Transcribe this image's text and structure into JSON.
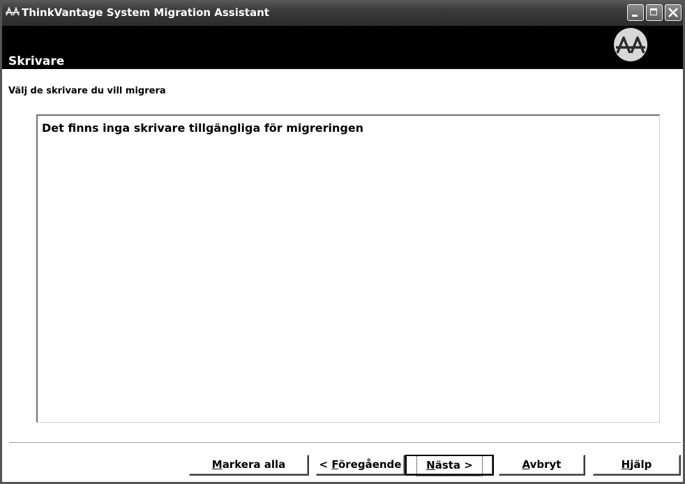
{
  "window": {
    "title": "ThinkVantage System Migration Assistant",
    "icon": "thinkvantage-app-icon"
  },
  "header": {
    "title": "Skrivare",
    "logo": "thinkvantage-logo"
  },
  "content": {
    "instruction": "Välj de skrivare du vill migrera",
    "list_empty_message": "Det finns inga skrivare tillgängliga för migreringen"
  },
  "buttons": {
    "select_all": {
      "mnemonic": "M",
      "rest": "arkera alla"
    },
    "back": {
      "prefix": "< ",
      "mnemonic": "F",
      "rest": "öregående"
    },
    "next": {
      "mnemonic": "N",
      "rest": "ästa >"
    },
    "cancel": {
      "mnemonic": "A",
      "rest": "vbryt"
    },
    "help": {
      "mnemonic": "H",
      "rest": "jälp"
    }
  },
  "colors": {
    "titlebar": "#3a3a3a",
    "header_band": "#000000",
    "background": "#ffffff"
  }
}
